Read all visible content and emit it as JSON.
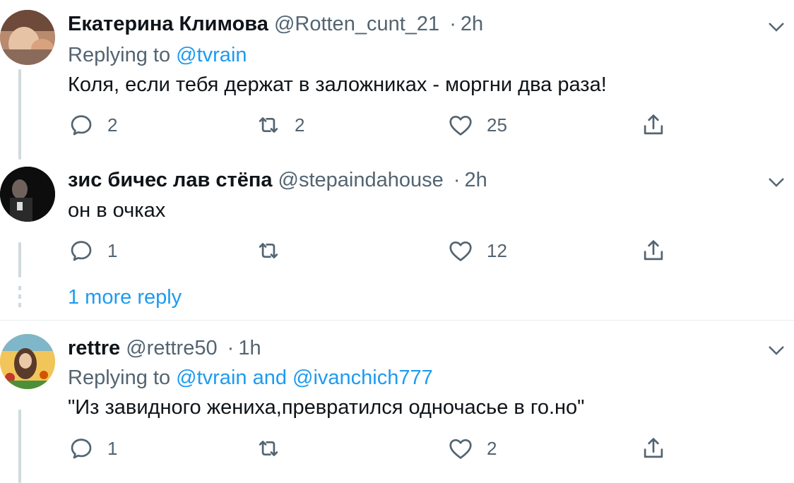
{
  "tweets": [
    {
      "name": "Екатерина Климова",
      "handle": "@Rotten_cunt_21",
      "time": "2h",
      "replying_prefix": "Replying to",
      "replying_users": "@tvrain",
      "text": "Коля, если тебя держат в заложниках - моргни два раза!",
      "reply_count": "2",
      "retweet_count": "2",
      "like_count": "25"
    },
    {
      "name": "зис бичес лав стёпа",
      "handle": "@stepaindahouse",
      "time": "2h",
      "text": "он в очках",
      "reply_count": "1",
      "retweet_count": "",
      "like_count": "12"
    },
    {
      "name": "rettre",
      "handle": "@rettre50",
      "time": "1h",
      "replying_prefix": "Replying to",
      "replying_users": "@tvrain and @ivanchich777",
      "text": "\"Из завидного жениха,превратился одночасье в го.но\"",
      "reply_count": "1",
      "retweet_count": "",
      "like_count": "2"
    }
  ],
  "more_replies": "1 more reply",
  "separator": "·",
  "colors": {
    "accent": "#1d9bf0",
    "muted": "#536471",
    "text": "#0f1419",
    "thread_line": "#cfd9de"
  },
  "icons": [
    "reply-icon",
    "retweet-icon",
    "like-icon",
    "share-icon",
    "chevron-down-icon"
  ]
}
